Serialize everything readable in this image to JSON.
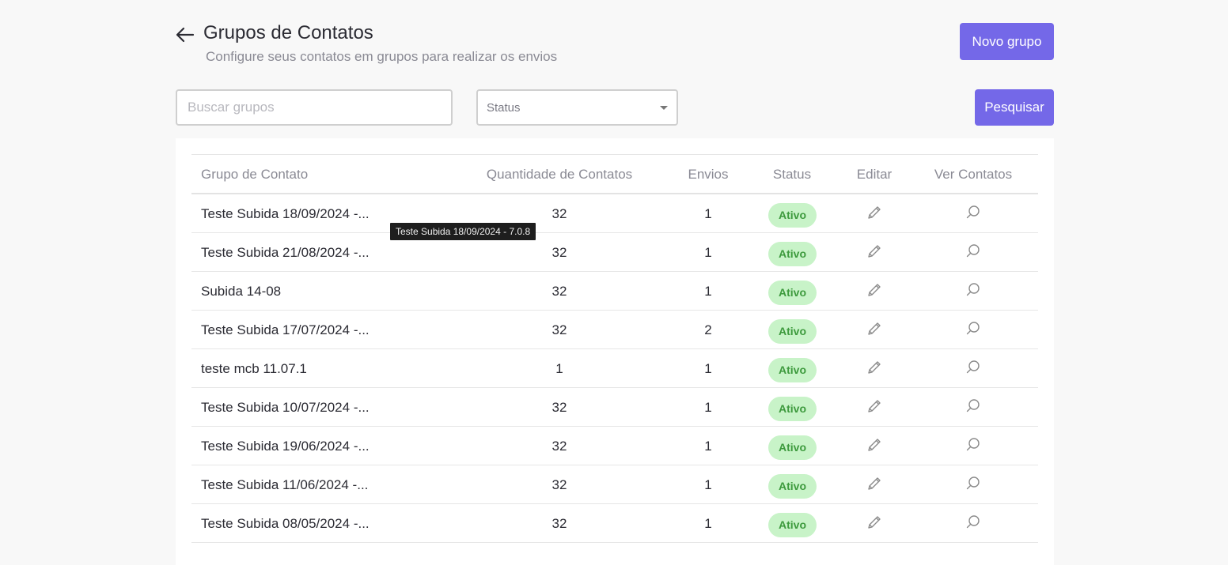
{
  "header": {
    "title": "Grupos de Contatos",
    "subtitle": "Configure seus contatos em grupos para realizar os envios",
    "new_group_label": "Novo grupo"
  },
  "filters": {
    "search_placeholder": "Buscar grupos",
    "search_value": "",
    "status_label": "Status",
    "search_button_label": "Pesquisar"
  },
  "table": {
    "headers": {
      "group": "Grupo de Contato",
      "quantity": "Quantidade de Contatos",
      "sends": "Envios",
      "status": "Status",
      "edit": "Editar",
      "view": "Ver Contatos"
    },
    "rows": [
      {
        "name": "Teste Subida 18/09/2024 -...",
        "quantity": "32",
        "sends": "1",
        "status": "Ativo"
      },
      {
        "name": "Teste Subida 21/08/2024 -...",
        "quantity": "32",
        "sends": "1",
        "status": "Ativo"
      },
      {
        "name": "Subida 14-08",
        "quantity": "32",
        "sends": "1",
        "status": "Ativo"
      },
      {
        "name": "Teste Subida 17/07/2024 -...",
        "quantity": "32",
        "sends": "2",
        "status": "Ativo"
      },
      {
        "name": "teste mcb 11.07.1",
        "quantity": "1",
        "sends": "1",
        "status": "Ativo"
      },
      {
        "name": "Teste Subida 10/07/2024 -...",
        "quantity": "32",
        "sends": "1",
        "status": "Ativo"
      },
      {
        "name": "Teste Subida 19/06/2024 -...",
        "quantity": "32",
        "sends": "1",
        "status": "Ativo"
      },
      {
        "name": "Teste Subida 11/06/2024 -...",
        "quantity": "32",
        "sends": "1",
        "status": "Ativo"
      },
      {
        "name": "Teste Subida 08/05/2024 -...",
        "quantity": "32",
        "sends": "1",
        "status": "Ativo"
      }
    ]
  },
  "tooltip": {
    "text": "Teste Subida 18/09/2024 - 7.0.8"
  },
  "colors": {
    "primary": "#7468e8",
    "active_badge_bg": "#c8f3c8",
    "active_badge_text": "#3d9a3d"
  },
  "icons": {
    "back": "arrow-left-icon",
    "edit": "pencil-icon",
    "view": "search-icon",
    "dropdown": "caret-down-icon"
  }
}
